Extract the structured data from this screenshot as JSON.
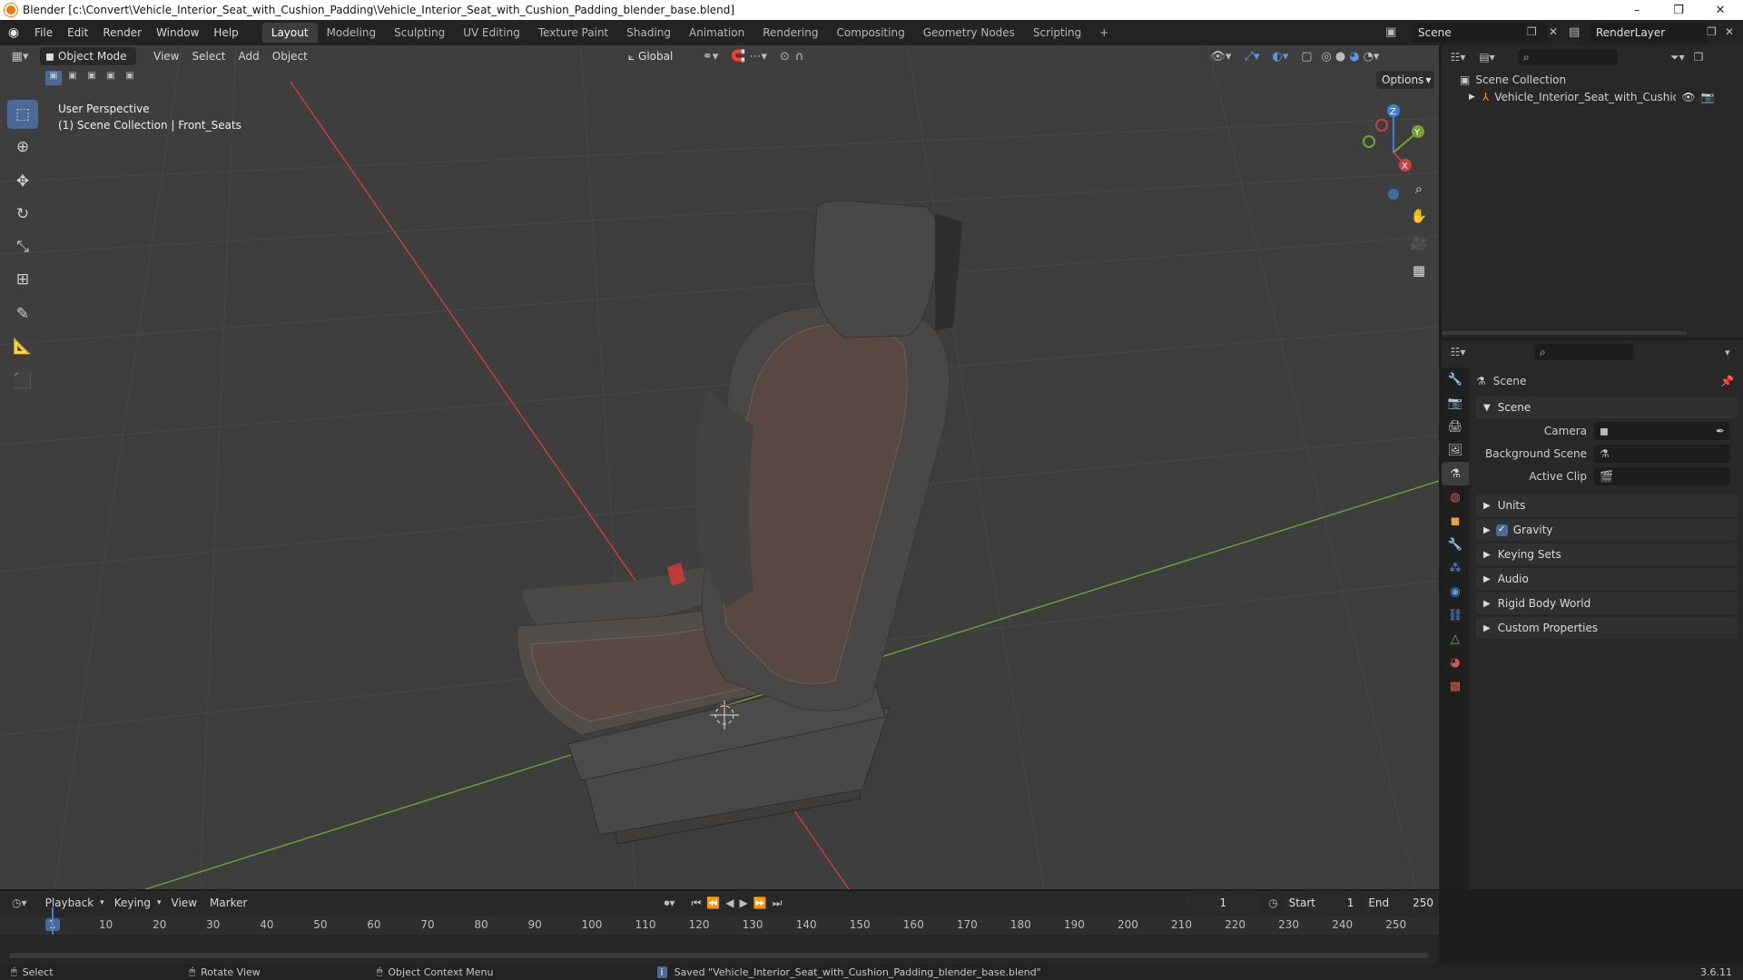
{
  "window": {
    "title": "Blender [c:\\Convert\\Vehicle_Interior_Seat_with_Cushion_Padding\\Vehicle_Interior_Seat_with_Cushion_Padding_blender_base.blend]",
    "minimize": "–",
    "maximize": "❐",
    "close": "✕"
  },
  "menu": [
    "File",
    "Edit",
    "Render",
    "Window",
    "Help"
  ],
  "workspaces": [
    "Layout",
    "Modeling",
    "Sculpting",
    "UV Editing",
    "Texture Paint",
    "Shading",
    "Animation",
    "Rendering",
    "Compositing",
    "Geometry Nodes",
    "Scripting",
    "+"
  ],
  "scene_name": "Scene",
  "render_layer": "RenderLayer",
  "viewport": {
    "mode": "Object Mode",
    "header_menu": [
      "View",
      "Select",
      "Add",
      "Object"
    ],
    "transform_orientation": "Global",
    "options_label": "Options",
    "overlay_line1": "User Perspective",
    "overlay_line2": "(1) Scene Collection | Front_Seats",
    "gizmo_axes": {
      "x": "X",
      "y": "Y",
      "z": "Z"
    },
    "colors": {
      "background": "#3e3e3e",
      "x_axis": "#c8403f",
      "y_axis": "#76a232",
      "z_axis": "#3f7fd6",
      "seat": "#4a4846",
      "seat_fabric": "#5a4843"
    }
  },
  "outliner": {
    "root": "Scene Collection",
    "item": "Vehicle_Interior_Seat_with_Cushion_Pac"
  },
  "properties": {
    "title": "Scene",
    "section_scene": "Scene",
    "camera_label": "Camera",
    "background_label": "Background Scene",
    "clip_label": "Active Clip",
    "sections": [
      "Units",
      "Gravity",
      "Keying Sets",
      "Audio",
      "Rigid Body World",
      "Custom Properties"
    ],
    "gravity_checked": true
  },
  "timeline": {
    "menu": [
      "Playback",
      "Keying",
      "View",
      "Marker"
    ],
    "current_frame": "1",
    "start_label": "Start",
    "start": "1",
    "end_label": "End",
    "end": "250",
    "ruler": [
      "1",
      "10",
      "20",
      "30",
      "40",
      "50",
      "60",
      "70",
      "80",
      "90",
      "100",
      "110",
      "120",
      "130",
      "140",
      "150",
      "160",
      "170",
      "180",
      "190",
      "200",
      "210",
      "220",
      "230",
      "240",
      "250"
    ]
  },
  "status": {
    "select": "Select",
    "rotate": "Rotate View",
    "context": "Object Context Menu",
    "saved": "Saved \"Vehicle_Interior_Seat_with_Cushion_Padding_blender_base.blend\"",
    "version": "3.6.11"
  }
}
